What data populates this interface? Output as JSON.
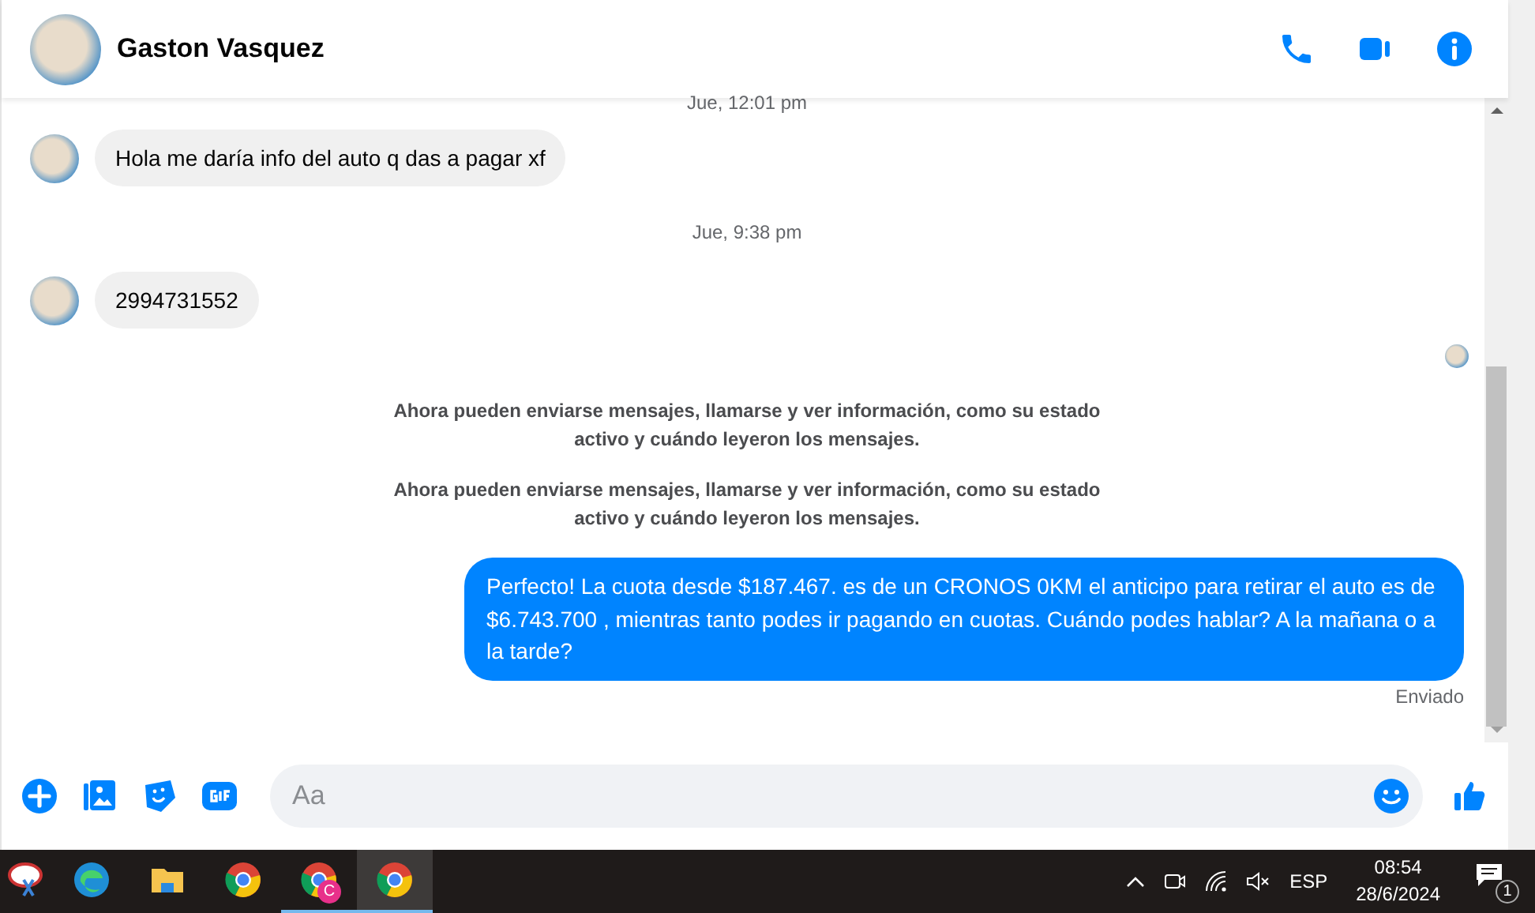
{
  "chat": {
    "contact_name": "Gaston Vasquez"
  },
  "messages": [
    {
      "kind": "timestamp",
      "text": "Jue, 12:01 pm"
    },
    {
      "kind": "incoming",
      "text": "Hola me daría info del auto q das a pagar xf"
    },
    {
      "kind": "timestamp",
      "text": "Jue, 9:38 pm"
    },
    {
      "kind": "incoming",
      "text": "2994731552"
    },
    {
      "kind": "seen"
    },
    {
      "kind": "system",
      "text": "Ahora pueden enviarse mensajes, llamarse y ver información, como su estado activo y cuándo leyeron los mensajes."
    },
    {
      "kind": "system",
      "text": "Ahora pueden enviarse mensajes, llamarse y ver información, como su estado activo y cuándo leyeron los mensajes."
    },
    {
      "kind": "outgoing",
      "text": "Perfecto! La cuota desde $187.467. es de un CRONOS 0KM el anticipo para retirar el auto es de $6.743.700 , mientras tanto podes ir pagando en cuotas. Cuándo podes hablar? A la mañana o a la tarde?"
    },
    {
      "kind": "status",
      "text": "Enviado"
    }
  ],
  "composer": {
    "placeholder": "Aa"
  },
  "taskbar": {
    "apps": [
      {
        "kind": "snip",
        "running": false,
        "selected": false
      },
      {
        "kind": "edge",
        "running": false,
        "selected": false
      },
      {
        "kind": "folder",
        "running": false,
        "selected": false
      },
      {
        "kind": "chrome",
        "running": false,
        "selected": false
      },
      {
        "kind": "chrome",
        "badge": "C",
        "running": true,
        "selected": false
      },
      {
        "kind": "chrome",
        "running": true,
        "selected": true
      }
    ],
    "language": "ESP",
    "time": "08:54",
    "date": "28/6/2024",
    "notifications": "1"
  }
}
